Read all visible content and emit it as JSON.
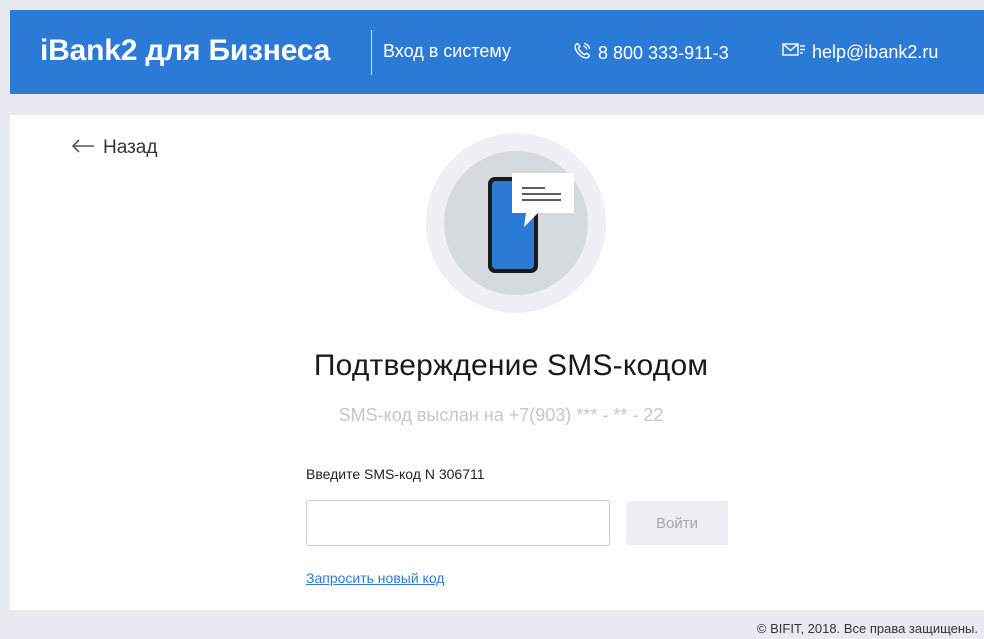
{
  "header": {
    "brand": "iBank2 для Бизнеса",
    "login_link": "Вход в систему",
    "phone": "8 800 333-911-3",
    "email": "help@ibank2.ru",
    "accent_color": "#2b7bd6"
  },
  "nav": {
    "back_label": "Назад"
  },
  "main": {
    "illustration_icon": "phone-sms-icon",
    "title": "Подтверждение SMS-кодом",
    "subtitle": "SMS-код выслан на +7(903) *** - ** - 22",
    "prompt": "Введите SMS-код N 306711",
    "code_value": "",
    "code_placeholder": "",
    "login_button": "Войти",
    "resend_link": "Запросить новый код"
  },
  "footer": {
    "copyright": "© BIFIT, 2018. Все права защищены."
  }
}
